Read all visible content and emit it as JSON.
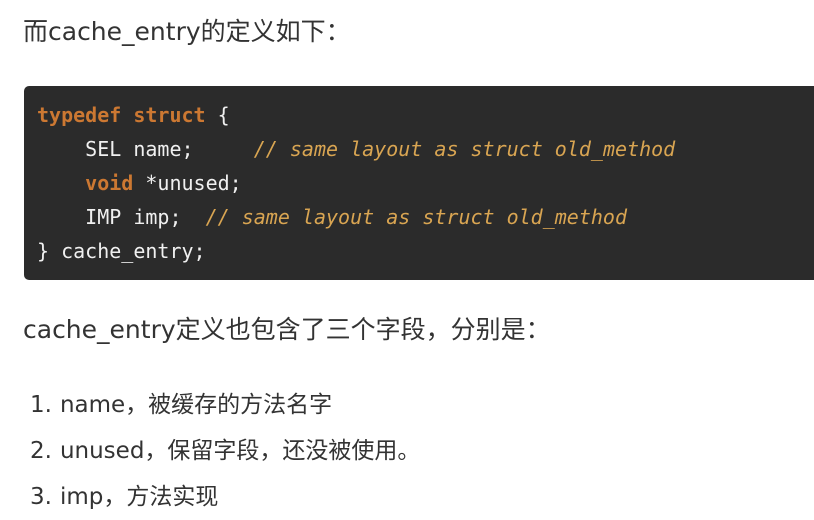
{
  "intro_text": "而cache_entry的定义如下：",
  "code": {
    "lines": [
      [
        {
          "t": "typedef",
          "c": "kw"
        },
        {
          "t": " ",
          "c": "pl"
        },
        {
          "t": "struct",
          "c": "kw"
        },
        {
          "t": " {",
          "c": "pl"
        }
      ],
      [
        {
          "t": "    SEL name;     ",
          "c": "pl"
        },
        {
          "t": "// same layout as struct old_method",
          "c": "cm"
        }
      ],
      [
        {
          "t": "    ",
          "c": "pl"
        },
        {
          "t": "void",
          "c": "kw"
        },
        {
          "t": " *unused;",
          "c": "pl"
        }
      ],
      [
        {
          "t": "    IMP imp;  ",
          "c": "pl"
        },
        {
          "t": "// same layout as struct old_method",
          "c": "cm"
        }
      ],
      [
        {
          "t": "} cache_entry;",
          "c": "pl"
        }
      ]
    ],
    "colors": {
      "background": "#2b2b2b",
      "keyword": "#cc7832",
      "comment": "#d9a552",
      "plain": "#f0f0f0"
    }
  },
  "summary_text": "cache_entry定义也包含了三个字段，分别是：",
  "list": [
    {
      "num": "1.",
      "text": "name，被缓存的方法名字"
    },
    {
      "num": "2.",
      "text": "unused，保留字段，还没被使用。"
    },
    {
      "num": "3.",
      "text": "imp，方法实现"
    }
  ]
}
